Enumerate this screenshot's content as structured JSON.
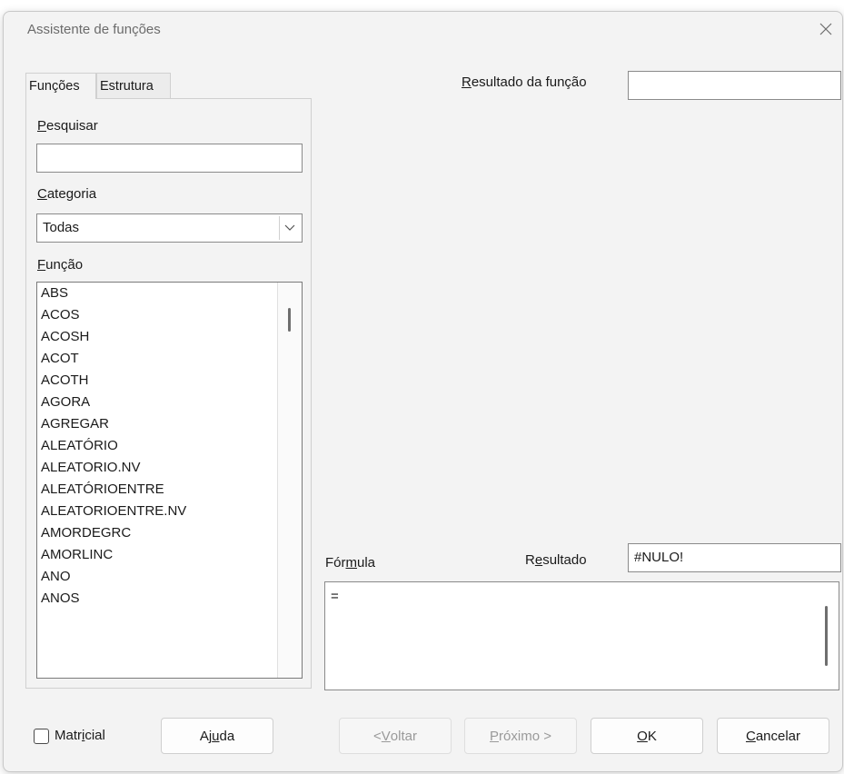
{
  "window": {
    "title": "Assistente de funções"
  },
  "tabs": [
    {
      "label": "Funções"
    },
    {
      "label": "Estrutura"
    }
  ],
  "search": {
    "label_first": "P",
    "label_rest": "esquisar",
    "value": ""
  },
  "category": {
    "label_first": "C",
    "label_rest": "ategoria",
    "selected": "Todas"
  },
  "function_list": {
    "label_first": "F",
    "label_rest": "unção",
    "items": [
      "ABS",
      "ACOS",
      "ACOSH",
      "ACOT",
      "ACOTH",
      "AGORA",
      "AGREGAR",
      "ALEATÓRIO",
      "ALEATORIO.NV",
      "ALEATÓRIOENTRE",
      "ALEATORIOENTRE.NV",
      "AMORDEGRC",
      "AMORLINC",
      "ANO",
      "ANOS"
    ]
  },
  "function_result": {
    "label_first": "R",
    "label_rest": "esultado da função",
    "value": ""
  },
  "formula": {
    "label_a": "Fór",
    "label_u": "m",
    "label_b": "ula",
    "value": "="
  },
  "result": {
    "label_a": "R",
    "label_u": "e",
    "label_b": "sultado",
    "value": "#NULO!"
  },
  "checkbox": {
    "label_a": "Matr",
    "label_u": "i",
    "label_b": "cial",
    "checked": false
  },
  "buttons": {
    "help": {
      "a": "Aj",
      "u": "u",
      "b": "da"
    },
    "back": {
      "a": "< ",
      "u": "V",
      "b": "oltar"
    },
    "next": {
      "a": "",
      "u": "P",
      "b": "róximo >"
    },
    "ok": {
      "a": "",
      "u": "O",
      "b": "K"
    },
    "cancel": {
      "a": "",
      "u": "C",
      "b": "ancelar"
    }
  },
  "icons": {
    "close": "close-icon",
    "dropdown": "chevron-down-icon"
  }
}
